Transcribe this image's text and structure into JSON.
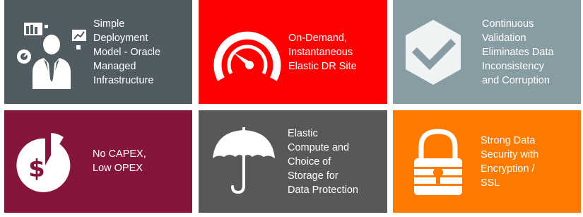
{
  "tiles": [
    {
      "label": "Simple\nDeployment\nModel - Oracle\nManaged\nInfrastructure",
      "icon": "managed-infrastructure-person-icon",
      "color": "#515c62"
    },
    {
      "label": "On-Demand,\nInstantaneous\nElastic DR Site",
      "icon": "speedometer-icon",
      "color": "#ff0000"
    },
    {
      "label": "Continuous\nValidation\nEliminates Data\nInconsistency\nand Corruption",
      "icon": "hexagon-checkmark-icon",
      "color": "#879ca3"
    },
    {
      "label": "No CAPEX,\nLow OPEX",
      "icon": "dollar-pie-chart-icon",
      "color": "#85153d"
    },
    {
      "label": "Elastic\nCompute and\nChoice of\nStorage for\nData Protection",
      "icon": "umbrella-icon",
      "color": "#585858"
    },
    {
      "label": "Strong Data\nSecurity with\nEncryption /\nSSL",
      "icon": "padlock-icon",
      "color": "#ff7b00"
    }
  ]
}
